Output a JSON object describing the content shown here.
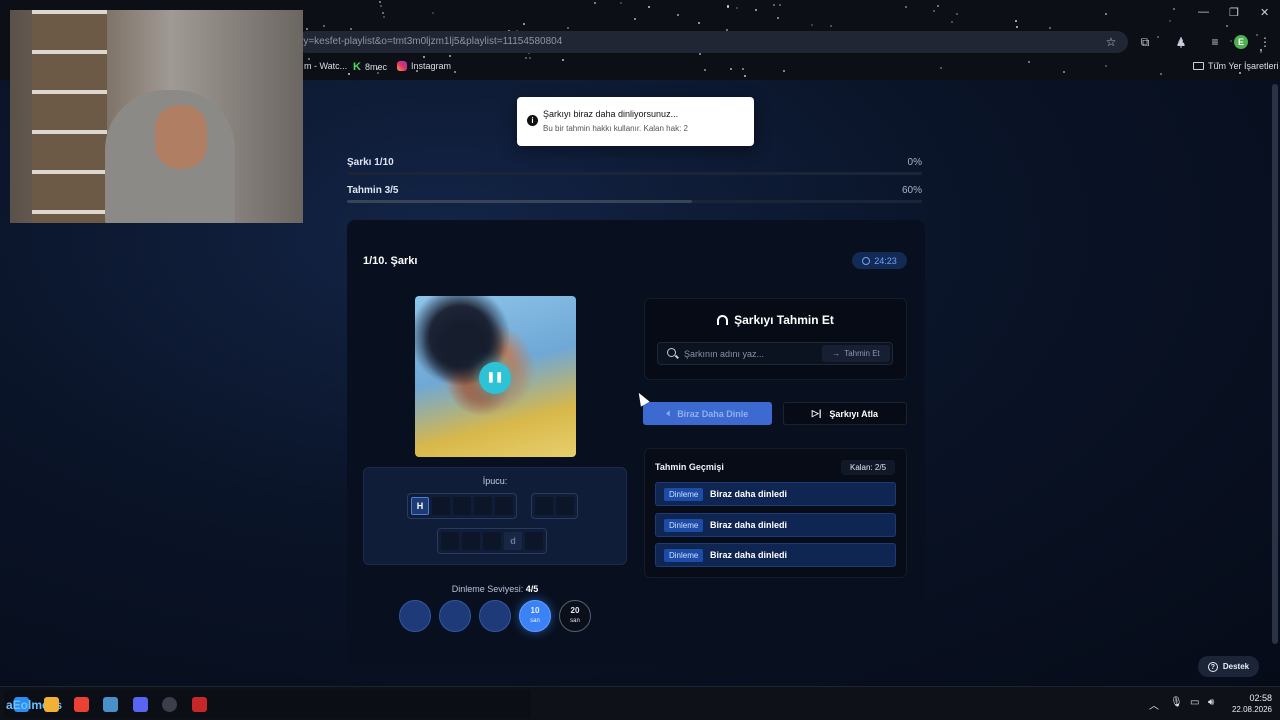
{
  "browser": {
    "url": "ry=kesfet-playlist&o=tmt3m0ljzm1lj5&playlist=11154580804",
    "bookmarks": [
      {
        "label": "m - Watc..."
      },
      {
        "label": "8mec"
      },
      {
        "label": "Instagram"
      }
    ],
    "all_bookmarks_label": "Tüm Yer İşaretleri",
    "profile_initial": "E"
  },
  "toast": {
    "title": "Şarkıyı biraz daha dinliyorsunuz...",
    "subtitle": "Bu bir tahmin hakkı kullanır. Kalan hak: 2",
    "icon": "info-icon"
  },
  "progress": {
    "song": {
      "label": "Şarkı 1/10",
      "percent_label": "0%",
      "fraction": 0.0
    },
    "guess": {
      "label": "Tahmin 3/5",
      "percent_label": "60%",
      "fraction": 0.6
    }
  },
  "game": {
    "song_heading": "1/10. Şarkı",
    "timer": "24:23",
    "play_state_icon": "pause-icon",
    "hint": {
      "label": "İpucu:",
      "groups": [
        [
          "H",
          "",
          "",
          "",
          ""
        ],
        [
          "",
          ""
        ],
        [
          "",
          "",
          "",
          "d",
          ""
        ]
      ]
    },
    "level": {
      "label": "Dinleme Seviyesi:",
      "value": "4/5",
      "options": [
        {
          "value": "",
          "unit": "",
          "state": "past"
        },
        {
          "value": "",
          "unit": "",
          "state": "past"
        },
        {
          "value": "",
          "unit": "",
          "state": "past"
        },
        {
          "value": "10",
          "unit": "san",
          "state": "current"
        },
        {
          "value": "20",
          "unit": "san",
          "state": "next"
        }
      ]
    }
  },
  "guess_panel": {
    "title": "Şarkıyı Tahmin Et",
    "placeholder": "Şarkının adını yaz...",
    "submit_label": "Tahmin Et"
  },
  "actions": {
    "listen_more": "Biraz Daha Dinle",
    "skip": "Şarkıyı Atla"
  },
  "history": {
    "title": "Tahmin Geçmişi",
    "remaining": "Kalan: 2/5",
    "rows": [
      {
        "tag": "Dinleme",
        "text": "Biraz daha dinledi"
      },
      {
        "tag": "Dinleme",
        "text": "Biraz daha dinledi"
      },
      {
        "tag": "Dinleme",
        "text": "Biraz daha dinledi"
      }
    ]
  },
  "support_label": "Destek",
  "taskbar": {
    "app_label": "aEolmess",
    "time": "02:58",
    "date": "22.08.2026"
  },
  "colors": {
    "accent": "#3b82f6",
    "page_bg": "#0a1428",
    "history_row": "#0f2552"
  }
}
